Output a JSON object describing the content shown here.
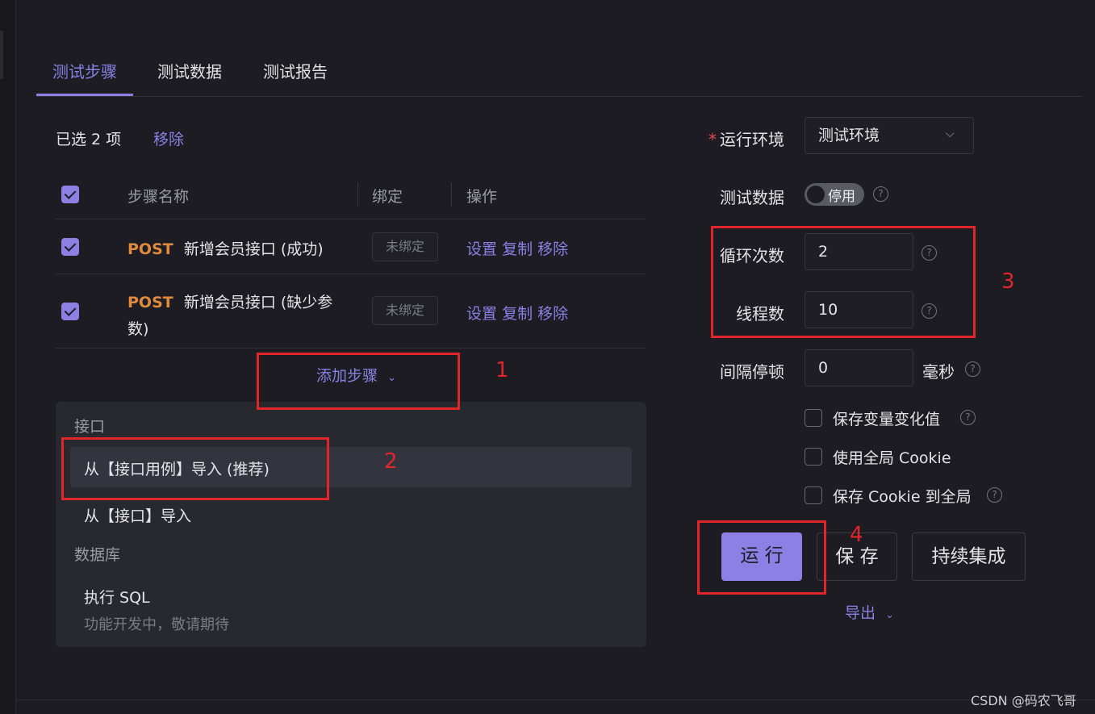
{
  "tabs": [
    {
      "label": "测试步骤",
      "active": true
    },
    {
      "label": "测试数据",
      "active": false
    },
    {
      "label": "测试报告",
      "active": false
    }
  ],
  "selection": {
    "text": "已选 2 项",
    "remove": "移除"
  },
  "table": {
    "headers": {
      "name": "步骤名称",
      "bind": "绑定",
      "ops": "操作"
    },
    "rows": [
      {
        "method": "POST",
        "name": "新增会员接口 (成功)",
        "bind": "未绑定",
        "ops": [
          "设置",
          "复制",
          "移除"
        ]
      },
      {
        "method": "POST",
        "name_line1": "新增会员接口 (缺少参",
        "name_line2": "数)",
        "bind": "未绑定",
        "ops": [
          "设置",
          "复制",
          "移除"
        ]
      }
    ]
  },
  "add_step": "添加步骤",
  "dropdown": {
    "group1": "接口",
    "item1": "从【接口用例】导入 (推荐)",
    "item2": "从【接口】导入",
    "group2": "数据库",
    "item3": "执行 SQL",
    "item3_sub": "功能开发中，敬请期待"
  },
  "form": {
    "env_label": "运行环境",
    "env_value": "测试环境",
    "data_label": "测试数据",
    "data_switch": "停用",
    "loop_label": "循环次数",
    "loop_value": "2",
    "thread_label": "线程数",
    "thread_value": "10",
    "interval_label": "间隔停顿",
    "interval_value": "0",
    "interval_unit": "毫秒",
    "options": [
      "保存变量变化值",
      "使用全局 Cookie",
      "保存 Cookie 到全局"
    ]
  },
  "buttons": {
    "run": "运 行",
    "save": "保 存",
    "ci": "持续集成",
    "export": "导出"
  },
  "annotations": [
    "1",
    "2",
    "3",
    "4"
  ],
  "watermark": "CSDN @码农飞哥",
  "colors": {
    "accent": "#8d7fe3",
    "method": "#e08a3d",
    "annotation": "#e0262a",
    "bg": "#1c1c22"
  }
}
